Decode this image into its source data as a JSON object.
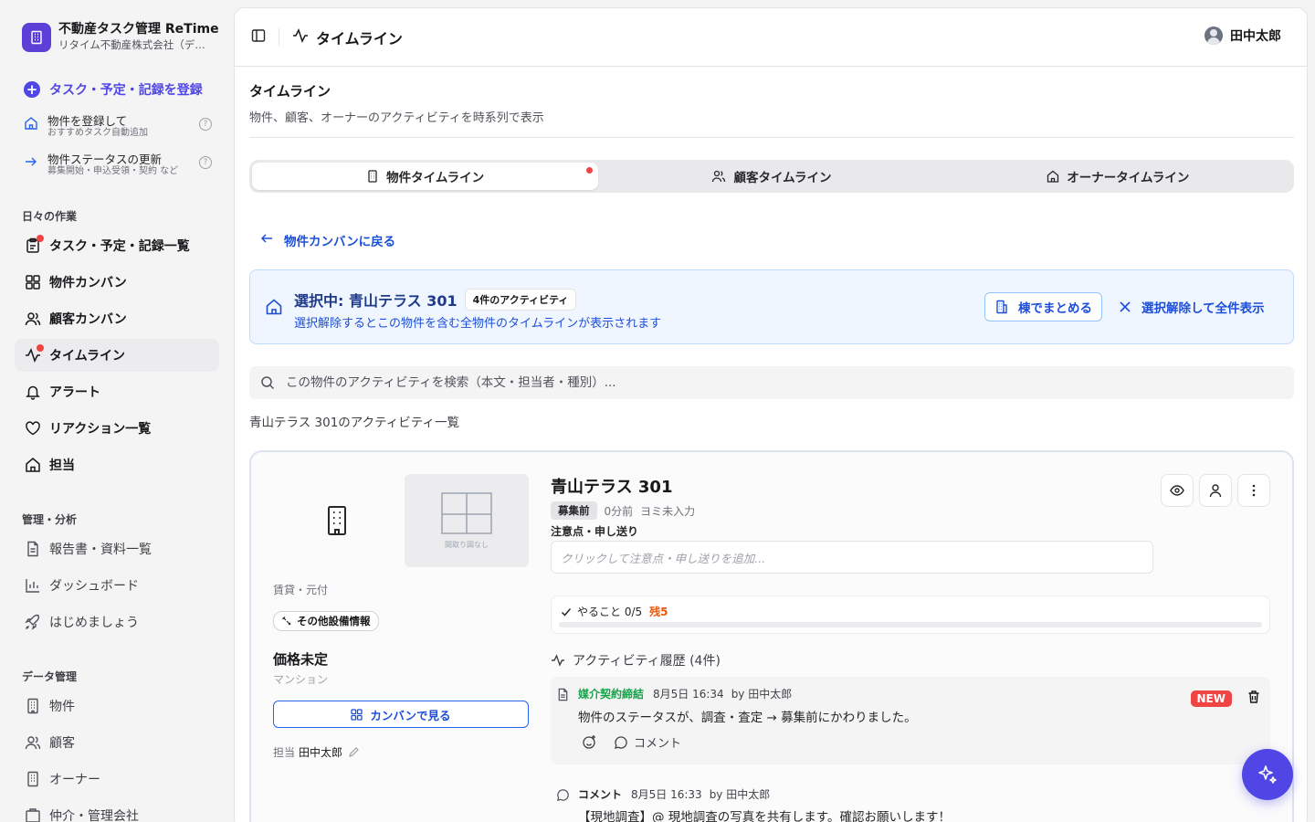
{
  "app": {
    "title": "不動産タスク管理 ReTime",
    "subtitle": "リタイム不動産株式会社（デモ）"
  },
  "sidebar": {
    "cta": "タスク・予定・記録を登録",
    "quick": [
      {
        "title": "物件を登録して",
        "sub": "おすすめタスク自動追加"
      },
      {
        "title": "物件ステータスの更新",
        "sub": "募集開始・申込受領・契約 など"
      }
    ],
    "sections": {
      "daily": "日々の作業",
      "manage": "管理・分析",
      "data": "データ管理"
    },
    "daily": [
      "タスク・予定・記録一覧",
      "物件カンバン",
      "顧客カンバン",
      "タイムライン",
      "アラート",
      "リアクション一覧",
      "担当"
    ],
    "manage": [
      "報告書・資料一覧",
      "ダッシュボード",
      "はじめましょう"
    ],
    "data": [
      "物件",
      "顧客",
      "オーナー",
      "仲介・管理会社"
    ]
  },
  "topbar": {
    "title": "タイムライン",
    "user": "田中太郎"
  },
  "page": {
    "title": "タイムライン",
    "description": "物件、顧客、オーナーのアクティビティを時系列で表示"
  },
  "tabs": [
    "物件タイムライン",
    "顧客タイムライン",
    "オーナータイムライン"
  ],
  "back": "物件カンバンに戻る",
  "selection": {
    "title": "選択中: 青山テラス 301",
    "count": "4件のアクティビティ",
    "description": "選択解除するとこの物件を含む全物件のタイムラインが表示されます",
    "group_btn": "棟でまとめる",
    "clear_btn": "選択解除して全件表示"
  },
  "search": {
    "placeholder": "この物件のアクティビティを検索（本文・担当者・種別）..."
  },
  "list_label": "青山テラス 301のアクティビティ一覧",
  "property": {
    "floorplan": "間取り図なし",
    "kind": "賃貸・元付",
    "equipment": "その他設備情報",
    "price": "価格未定",
    "type": "マンション",
    "kanban_btn": "カンバンで見る",
    "assignee_label": "担当",
    "assignee": "田中太郎",
    "name": "青山テラス 301",
    "status": "募集前",
    "updated": "0分前",
    "yomi": "ヨミ未入力",
    "notes_label": "注意点・申し送り",
    "notes_placeholder": "クリックして注意点・申し送りを追加...",
    "todo": "やること 0/5",
    "todo_remaining": "残5",
    "todo_progress": 0
  },
  "activity": {
    "header": "アクティビティ履歴 (4件)",
    "items": [
      {
        "type": "媒介契約締結",
        "time": "8月5日 16:34",
        "by": "by 田中太郎",
        "body": "物件のステータスが、調査・査定 → 募集前にかわりました。",
        "badge": "NEW",
        "comment": "コメント",
        "type_color": "#16a34a"
      },
      {
        "type": "コメント",
        "time": "8月5日 16:33",
        "by": "by 田中太郎",
        "body": "【現地調査】@ 現地調査の写真を共有します。確認お願いします！",
        "type_color": "#27272a"
      }
    ]
  }
}
